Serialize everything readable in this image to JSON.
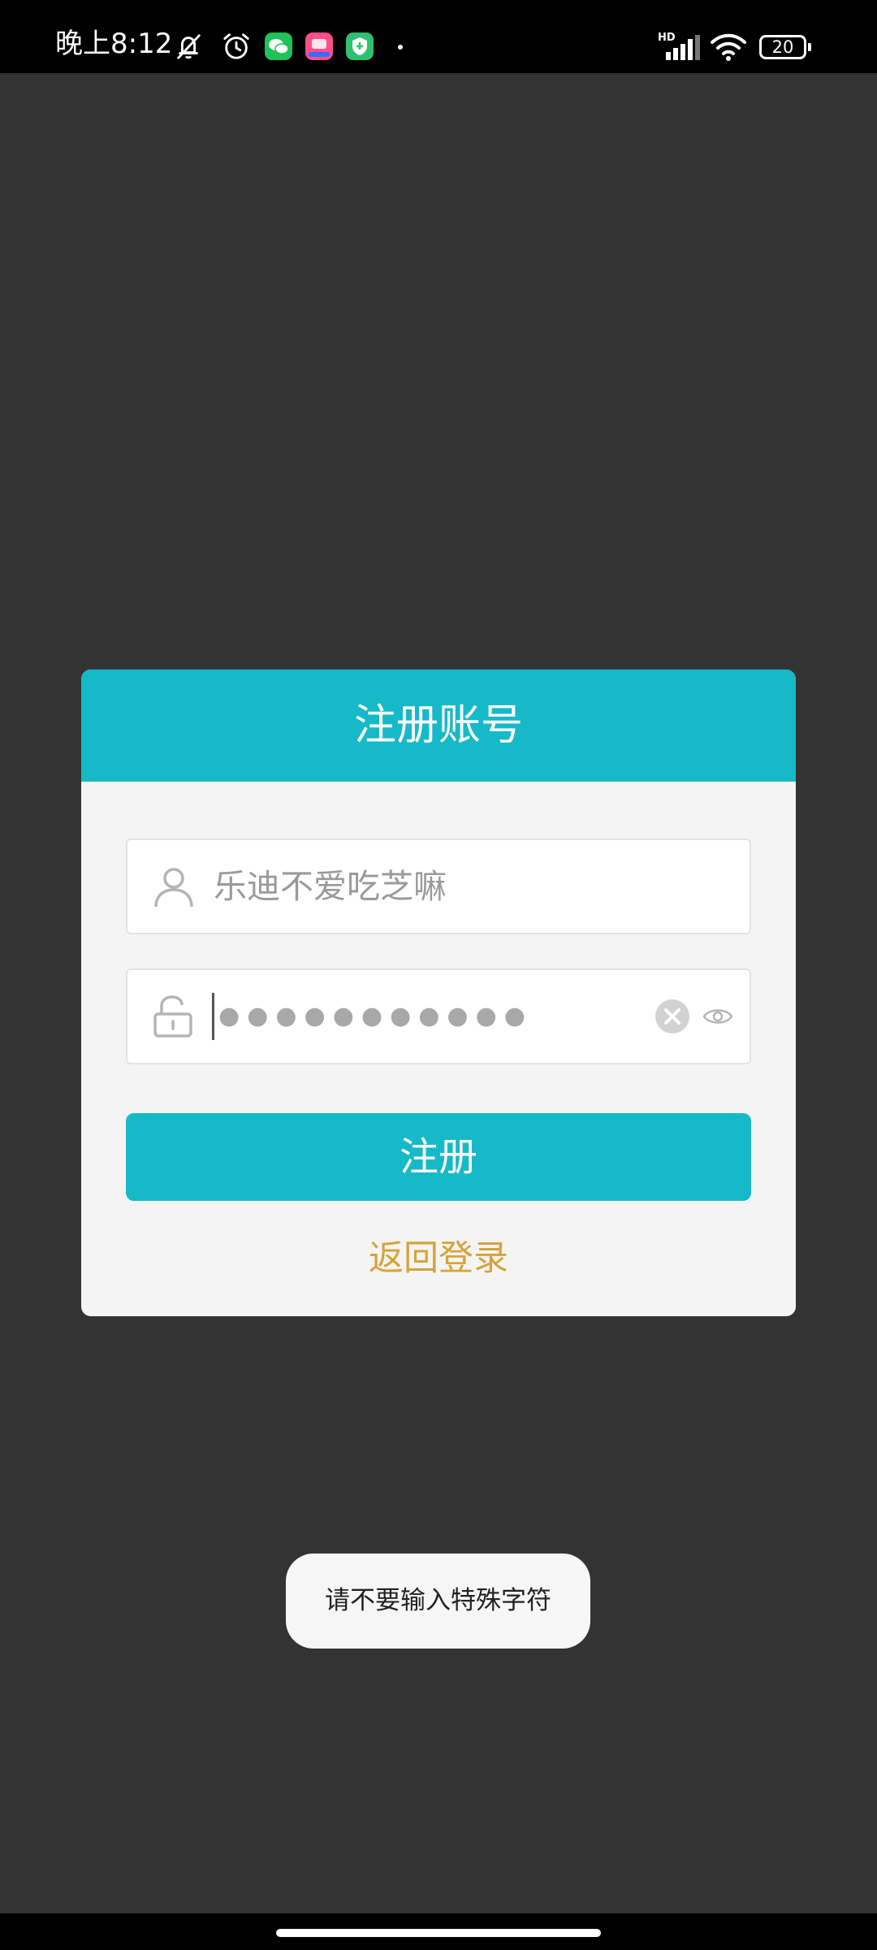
{
  "status_bar": {
    "time": "晚上8:12",
    "network_label": "HD",
    "battery_level": "20",
    "icons": [
      "notifications-off-icon",
      "alarm-icon",
      "wechat-icon",
      "app-icon",
      "security-icon",
      "signal-icon",
      "wifi-icon",
      "battery-icon"
    ]
  },
  "dialog": {
    "title": "注册账号",
    "username": {
      "icon": "user-icon",
      "value": "乐迪不爱吃芝嘛"
    },
    "password": {
      "icon": "lock-icon",
      "masked_value": "●●●●●●●●●●●",
      "clear_icon": "clear-icon",
      "visibility_icon": "eye-icon"
    },
    "register_label": "注册",
    "back_to_login_label": "返回登录"
  },
  "toast": {
    "message": "请不要输入特殊字符"
  },
  "colors": {
    "accent": "#16b9c8",
    "link": "#d6a33a",
    "background": "#333333",
    "dialog_background": "#f4f4f4"
  }
}
